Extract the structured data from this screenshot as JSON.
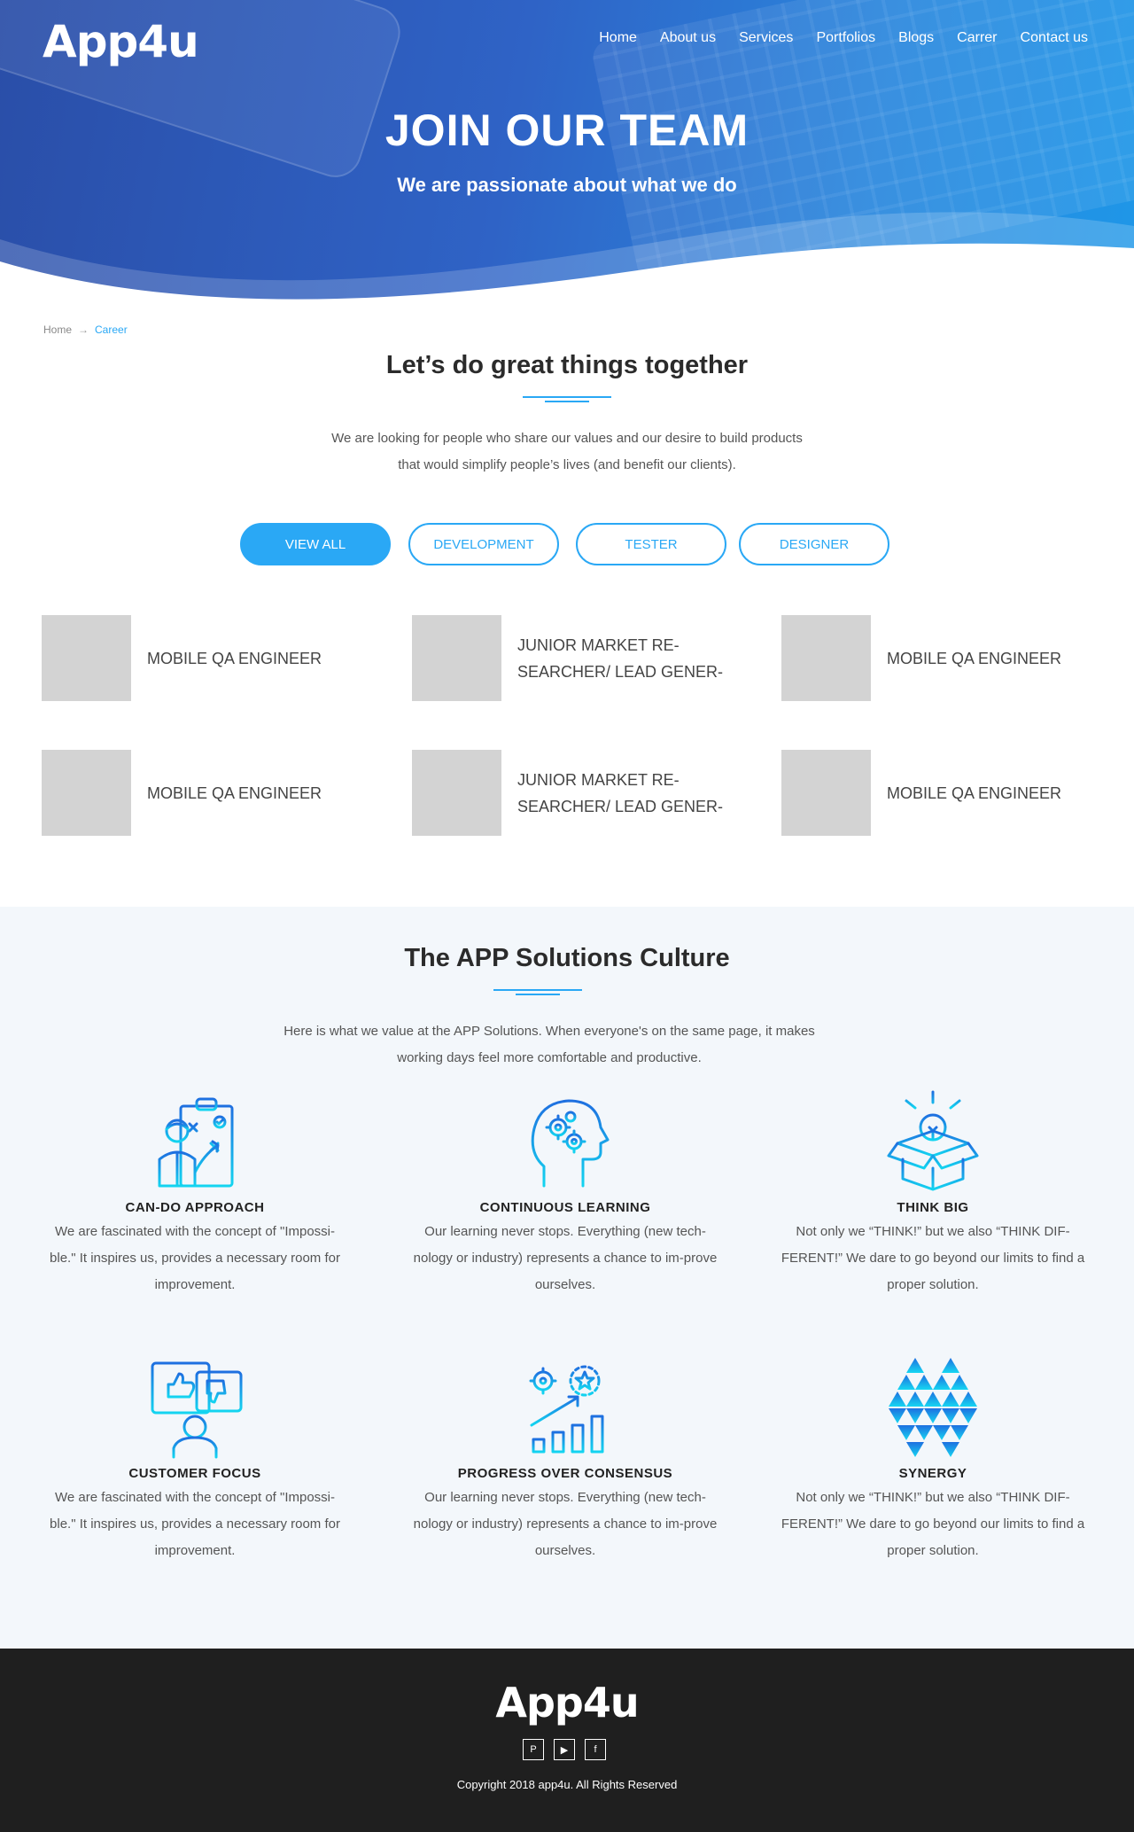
{
  "header": {
    "logo": "App4u",
    "nav": [
      "Home",
      "About us",
      "Services",
      "Portfolios",
      "Blogs",
      "Carrer",
      "Contact us"
    ],
    "title": "JOIN OUR TEAM",
    "subtitle": "We are passionate about what we do"
  },
  "breadcrumb": {
    "home": "Home",
    "arrow": "→",
    "current": "Career"
  },
  "intro": {
    "title": "Let’s do great things together",
    "description": "We are looking for people who share our values and our desire to build products that would simplify people’s lives (and benefit our clients)."
  },
  "filters": {
    "items": [
      "VIEW ALL",
      "DEVELOPMENT",
      "TESTER",
      "DESIGNER"
    ],
    "active": "VIEW ALL"
  },
  "jobs": [
    {
      "title": "MOBILE QA ENGINEER"
    },
    {
      "title": "JUNIOR MARKET RE-SEARCHER/ LEAD GENER-"
    },
    {
      "title": "MOBILE QA ENGINEER"
    },
    {
      "title": "MOBILE QA ENGINEER"
    },
    {
      "title": "JUNIOR MARKET RE-SEARCHER/ LEAD GENER-"
    },
    {
      "title": "MOBILE QA ENGINEER"
    }
  ],
  "culture": {
    "title": "The APP Solutions Culture",
    "description": "Here is what we value at the APP Solutions. When everyone's on the same page, it makes working days feel more comfortable and productive.",
    "values": [
      {
        "icon": "strategy-board-icon",
        "title": "CAN-DO APPROACH",
        "description": "We are fascinated with the concept of \"Impossi-ble.\" It inspires us, provides a necessary room for improvement."
      },
      {
        "icon": "head-gears-icon",
        "title": "CONTINUOUS LEARNING",
        "description": "Our learning never stops. Everything (new tech-nology or industry) represents a chance to im-prove ourselves."
      },
      {
        "icon": "lightbulb-box-icon",
        "title": "THINK BIG",
        "description": "Not only we “THINK!” but we also “THINK DIF-FERENT!” We dare to go beyond our limits to find a proper solution."
      },
      {
        "icon": "feedback-thumbs-icon",
        "title": "CUSTOMER FOCUS",
        "description": "We are fascinated with the concept of \"Impossi-ble.\" It inspires us, provides a necessary room for improvement."
      },
      {
        "icon": "growth-chart-icon",
        "title": "PROGRESS OVER CONSENSUS",
        "description": "Our learning never stops. Everything (new tech-nology or industry) represents a chance to im-prove ourselves."
      },
      {
        "icon": "triangles-synergy-icon",
        "title": "SYNERGY",
        "description": "Not only we “THINK!” but we also “THINK DIF-FERENT!” We dare to go beyond our limits to find a proper solution."
      }
    ]
  },
  "footer": {
    "logo": "App4u",
    "social": [
      {
        "icon": "pinterest-icon",
        "glyph": "P"
      },
      {
        "icon": "youtube-icon",
        "glyph": "▶"
      },
      {
        "icon": "facebook-icon",
        "glyph": "f"
      }
    ],
    "copyright": "Copyright 2018 app4u. All Rights Reserved"
  },
  "colors": {
    "accent": "#2aa8f5",
    "hero_start": "#2a4ea8",
    "hero_end": "#1e97e8",
    "footer_bg": "#1f1f1f",
    "culture_bg": "#f3f7fb",
    "thumb": "#d3d3d3"
  }
}
